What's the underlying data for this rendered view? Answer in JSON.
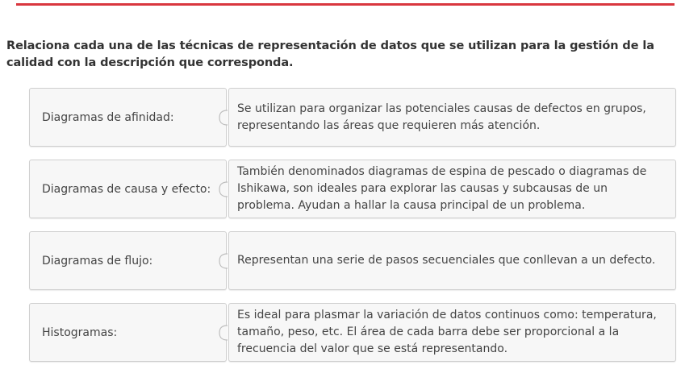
{
  "header": {
    "accent_color": "#d9363e"
  },
  "question": {
    "text": "Relaciona cada una de las técnicas de representación de datos que se utilizan para la gestión de la calidad con la descripción que corresponda."
  },
  "pairs": [
    {
      "term": "Diagramas de afinidad:",
      "description": "Se utilizan para organizar las potenciales causas de defectos en grupos, representando las áreas que requieren más atención."
    },
    {
      "term": "Diagramas de causa y efecto:",
      "description": "También denominados diagramas de espina de pescado o diagramas de Ishikawa, son ideales para explorar las causas y subcausas de un problema. Ayudan a hallar la causa principal de un problema."
    },
    {
      "term": "Diagramas de flujo:",
      "description": "Representan una serie de pasos secuenciales que conllevan a un defecto."
    },
    {
      "term": "Histogramas:",
      "description": "Es ideal para plasmar la variación de datos continuos como: temperatura, tamaño, peso, etc. El área de cada barra debe ser proporcional a la frecuencia del valor que se está representando."
    }
  ]
}
